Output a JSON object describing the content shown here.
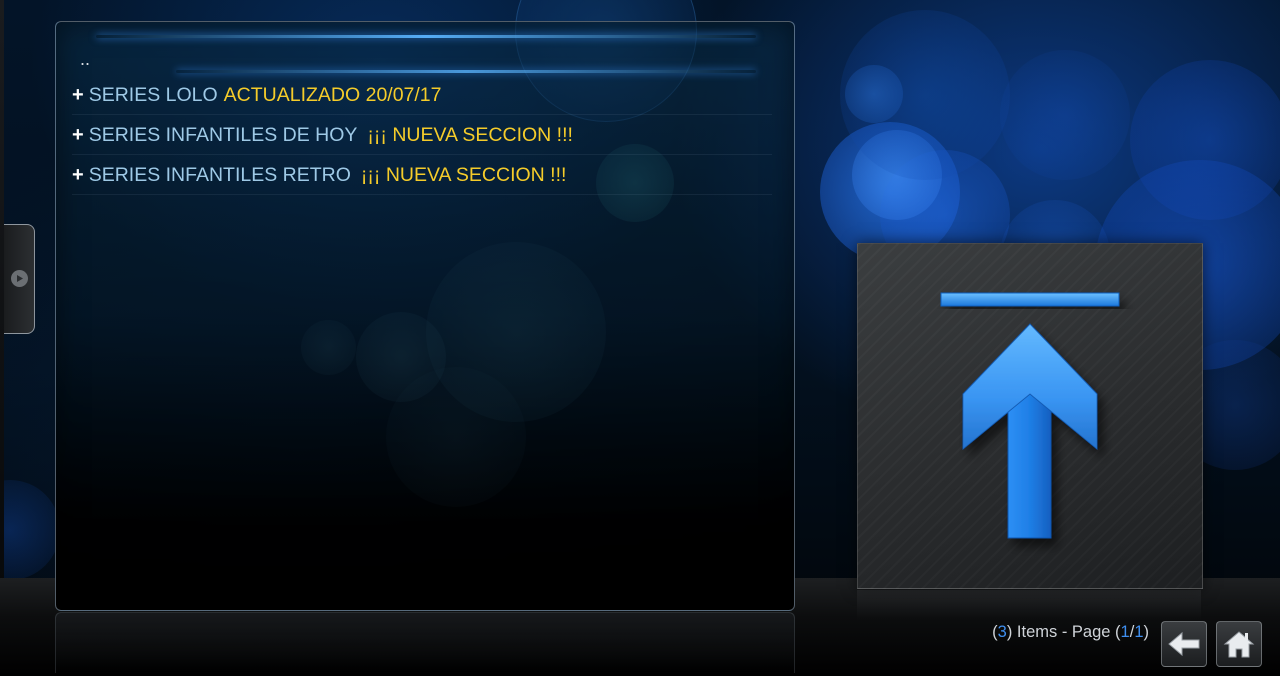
{
  "file_list": {
    "parent_label": "..",
    "items": [
      {
        "plus": "+",
        "name": "SERIES LOLO",
        "tag": "ACTUALIZADO 20/07/17"
      },
      {
        "plus": "+",
        "name": "SERIES INFANTILES DE HOY",
        "tag": "¡¡¡ NUEVA SECCION !!!"
      },
      {
        "plus": "+",
        "name": "SERIES INFANTILES RETRO",
        "tag": "¡¡¡ NUEVA SECCION !!!"
      }
    ]
  },
  "footer": {
    "items_open": "(",
    "items_count": "3",
    "items_mid": ") Items - Page (",
    "page_current": "1",
    "page_sep": "/",
    "page_total": "1",
    "items_close": ")"
  },
  "thumbnail": {
    "icon": "up-arrow-icon"
  },
  "nav": {
    "back_icon": "back-arrow-icon",
    "home_icon": "home-icon"
  },
  "colors": {
    "accent_blue": "#1f7fe6",
    "item_name": "#9ec9e6",
    "item_tag": "#f5cc2a",
    "count_highlight": "#3f8ff0"
  }
}
